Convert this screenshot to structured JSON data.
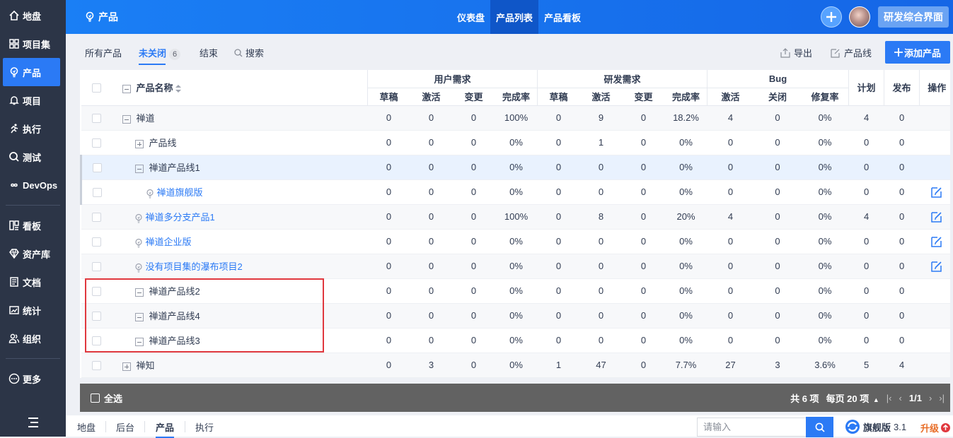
{
  "sidebar": {
    "items": [
      {
        "label": "地盘",
        "icon": "home-icon"
      },
      {
        "label": "项目集",
        "icon": "grid-icon"
      },
      {
        "label": "产品",
        "icon": "lightbulb-icon",
        "active": true
      },
      {
        "label": "项目",
        "icon": "bell-icon"
      },
      {
        "label": "执行",
        "icon": "runner-icon"
      },
      {
        "label": "测试",
        "icon": "search-icon"
      },
      {
        "label": "DevOps",
        "icon": "infinity-icon"
      },
      {
        "label": "看板",
        "icon": "kanban-icon"
      },
      {
        "label": "资产库",
        "icon": "diamond-icon"
      },
      {
        "label": "文档",
        "icon": "document-icon"
      },
      {
        "label": "统计",
        "icon": "chart-icon"
      },
      {
        "label": "组织",
        "icon": "people-icon"
      },
      {
        "label": "更多",
        "icon": "more-icon"
      }
    ]
  },
  "header": {
    "title": "产品",
    "tabs": [
      {
        "label": "仪表盘",
        "active": false
      },
      {
        "label": "产品列表",
        "active": true
      },
      {
        "label": "产品看板",
        "active": false
      }
    ],
    "workbench_label": "研发综合界面"
  },
  "toolbar": {
    "tabs": [
      {
        "label": "所有产品",
        "active": false
      },
      {
        "label": "未关闭",
        "active": true,
        "count": "6"
      },
      {
        "label": "结束",
        "active": false
      },
      {
        "label": "搜索",
        "active": false,
        "icon": "search-icon"
      }
    ],
    "export_label": "导出",
    "product_line_label": "产品线",
    "add_label": "添加产品"
  },
  "table": {
    "name_header": "产品名称",
    "groups": [
      "用户需求",
      "研发需求",
      "Bug"
    ],
    "story_columns": [
      "草稿",
      "激活",
      "变更",
      "完成率"
    ],
    "bug_columns": [
      "激活",
      "关闭",
      "修复率"
    ],
    "plan_header": "计划",
    "release_header": "发布",
    "action_header": "操作",
    "rows": [
      {
        "name": "禅道",
        "level": 0,
        "toggle": "minus",
        "kind": "program",
        "ur": [
          "0",
          "0",
          "0",
          "100%"
        ],
        "sr": [
          "0",
          "9",
          "0",
          "18.2%"
        ],
        "bug": [
          "4",
          "0",
          "0%"
        ],
        "plan": "4",
        "release": "0",
        "edit": false
      },
      {
        "name": "产品线",
        "level": 1,
        "toggle": "plus",
        "kind": "line",
        "ur": [
          "0",
          "0",
          "0",
          "0%"
        ],
        "sr": [
          "0",
          "1",
          "0",
          "0%"
        ],
        "bug": [
          "0",
          "0",
          "0%"
        ],
        "plan": "0",
        "release": "0",
        "edit": false
      },
      {
        "name": "禅道产品线1",
        "level": 1,
        "toggle": "minus",
        "kind": "line",
        "ur": [
          "0",
          "0",
          "0",
          "0%"
        ],
        "sr": [
          "0",
          "0",
          "0",
          "0%"
        ],
        "bug": [
          "0",
          "0",
          "0%"
        ],
        "plan": "0",
        "release": "0",
        "edit": false,
        "highlight": true
      },
      {
        "name": "禅道旗舰版",
        "level": 2,
        "toggle": "none",
        "kind": "product",
        "ur": [
          "0",
          "0",
          "0",
          "0%"
        ],
        "sr": [
          "0",
          "0",
          "0",
          "0%"
        ],
        "bug": [
          "0",
          "0",
          "0%"
        ],
        "plan": "0",
        "release": "0",
        "edit": true
      },
      {
        "name": "禅道多分支产品1",
        "level": 1,
        "toggle": "none",
        "kind": "product",
        "ur": [
          "0",
          "0",
          "0",
          "100%"
        ],
        "sr": [
          "0",
          "8",
          "0",
          "20%"
        ],
        "bug": [
          "4",
          "0",
          "0%"
        ],
        "plan": "4",
        "release": "0",
        "edit": true
      },
      {
        "name": "禅道企业版",
        "level": 1,
        "toggle": "none",
        "kind": "product",
        "ur": [
          "0",
          "0",
          "0",
          "0%"
        ],
        "sr": [
          "0",
          "0",
          "0",
          "0%"
        ],
        "bug": [
          "0",
          "0",
          "0%"
        ],
        "plan": "0",
        "release": "0",
        "edit": true
      },
      {
        "name": "没有项目集的瀑布项目2",
        "level": 1,
        "toggle": "none",
        "kind": "product",
        "ur": [
          "0",
          "0",
          "0",
          "0%"
        ],
        "sr": [
          "0",
          "0",
          "0",
          "0%"
        ],
        "bug": [
          "0",
          "0",
          "0%"
        ],
        "plan": "0",
        "release": "0",
        "edit": true
      },
      {
        "name": "禅道产品线2",
        "level": 1,
        "toggle": "minus",
        "kind": "line",
        "ur": [
          "0",
          "0",
          "0",
          "0%"
        ],
        "sr": [
          "0",
          "0",
          "0",
          "0%"
        ],
        "bug": [
          "0",
          "0",
          "0%"
        ],
        "plan": "0",
        "release": "0",
        "edit": false
      },
      {
        "name": "禅道产品线4",
        "level": 1,
        "toggle": "minus",
        "kind": "line",
        "ur": [
          "0",
          "0",
          "0",
          "0%"
        ],
        "sr": [
          "0",
          "0",
          "0",
          "0%"
        ],
        "bug": [
          "0",
          "0",
          "0%"
        ],
        "plan": "0",
        "release": "0",
        "edit": false
      },
      {
        "name": "禅道产品线3",
        "level": 1,
        "toggle": "minus",
        "kind": "line",
        "ur": [
          "0",
          "0",
          "0",
          "0%"
        ],
        "sr": [
          "0",
          "0",
          "0",
          "0%"
        ],
        "bug": [
          "0",
          "0",
          "0%"
        ],
        "plan": "0",
        "release": "0",
        "edit": false
      },
      {
        "name": "禅知",
        "level": 0,
        "toggle": "plus",
        "kind": "program",
        "ur": [
          "0",
          "3",
          "0",
          "0%"
        ],
        "sr": [
          "1",
          "47",
          "0",
          "7.7%"
        ],
        "bug": [
          "27",
          "3",
          "3.6%"
        ],
        "plan": "5",
        "release": "4",
        "edit": false
      }
    ]
  },
  "footer": {
    "select_all_label": "全选",
    "total_label": "共 6 项",
    "per_page_label": "每页 20 项",
    "page_label": "1/1"
  },
  "statusbar": {
    "crumbs": [
      {
        "label": "地盘",
        "active": false
      },
      {
        "label": "后台",
        "active": false
      },
      {
        "label": "产品",
        "active": true
      },
      {
        "label": "执行",
        "active": false
      }
    ],
    "search_placeholder": "请输入",
    "edition_label": "旗舰版",
    "version": "3.1",
    "upgrade_label": "升级"
  },
  "colors": {
    "accent": "#2b7af5",
    "sidebar_bg": "#2c3547",
    "footer_bg": "#626262",
    "highlight_box": "#e0383e",
    "upgrade": "#e86e28"
  }
}
